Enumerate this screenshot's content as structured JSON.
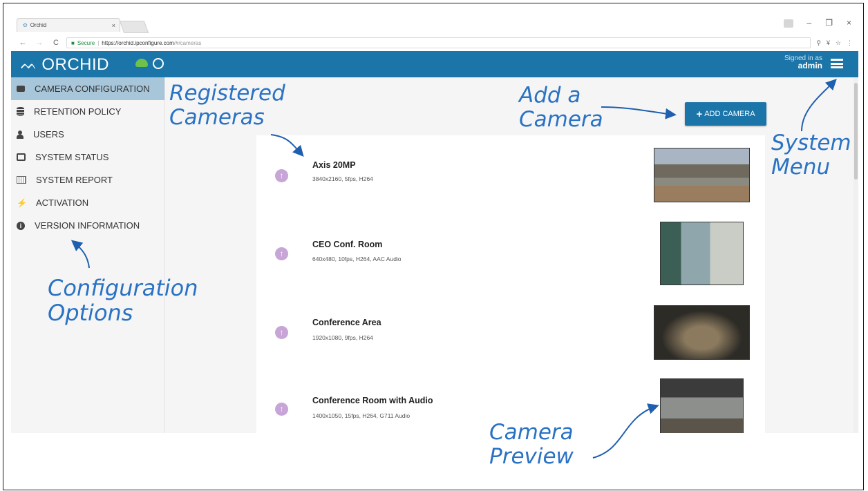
{
  "browser": {
    "tab_title": "Orchid",
    "tab_close": "×",
    "window_controls": {
      "minimize": "–",
      "restore": "❐",
      "close": "×"
    },
    "secure_label": "Secure",
    "url_host": "https://orchid.ipconfigure.com",
    "url_path": "/#/cameras"
  },
  "header": {
    "app_name": "ORCHID",
    "signed_in_label": "Signed in as",
    "username": "admin"
  },
  "sidebar": {
    "items": [
      {
        "label": "CAMERA CONFIGURATION",
        "icon": "video-camera-icon"
      },
      {
        "label": "RETENTION POLICY",
        "icon": "database-icon"
      },
      {
        "label": "USERS",
        "icon": "user-icon"
      },
      {
        "label": "SYSTEM STATUS",
        "icon": "status-icon"
      },
      {
        "label": "SYSTEM REPORT",
        "icon": "report-icon"
      },
      {
        "label": "ACTIVATION",
        "icon": "plug-icon"
      },
      {
        "label": "VERSION INFORMATION",
        "icon": "info-icon"
      }
    ]
  },
  "main": {
    "add_camera_label": "ADD CAMERA",
    "cameras": [
      {
        "name": "Axis 20MP",
        "spec": "3840x2160, 5fps, H264"
      },
      {
        "name": "CEO Conf. Room",
        "spec": "640x480, 10fps, H264, AAC Audio"
      },
      {
        "name": "Conference Area",
        "spec": "1920x1080, 9fps, H264"
      },
      {
        "name": "Conference Room with Audio",
        "spec": "1400x1050, 15fps, H264, G711 Audio"
      }
    ]
  },
  "annotations": {
    "registered_cameras_1": "Registered",
    "registered_cameras_2": "Cameras",
    "add_camera_1": "Add a",
    "add_camera_2": "Camera",
    "system_menu_1": "System",
    "system_menu_2": "Menu",
    "config_options_1": "Configuration",
    "config_options_2": "Options",
    "camera_preview_1": "Camera",
    "camera_preview_2": "Preview",
    "color": "#2a72c4"
  }
}
